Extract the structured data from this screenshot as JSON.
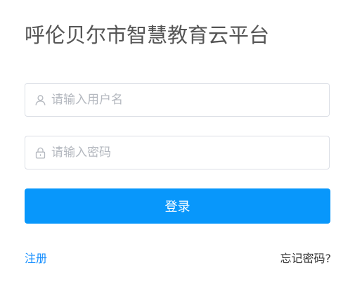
{
  "title": "呼伦贝尔市智慧教育云平台",
  "username": {
    "placeholder": "请输入用户名",
    "value": "",
    "icon": "user-icon"
  },
  "password": {
    "placeholder": "请输入密码",
    "value": "",
    "icon": "lock-icon"
  },
  "login_button": "登录",
  "register_link": "注册",
  "forgot_link": "忘记密码?",
  "colors": {
    "primary": "#0897fb",
    "link": "#1890ff",
    "title": "#555555",
    "border": "#dcdfe6",
    "placeholder": "#b4b8bf"
  }
}
